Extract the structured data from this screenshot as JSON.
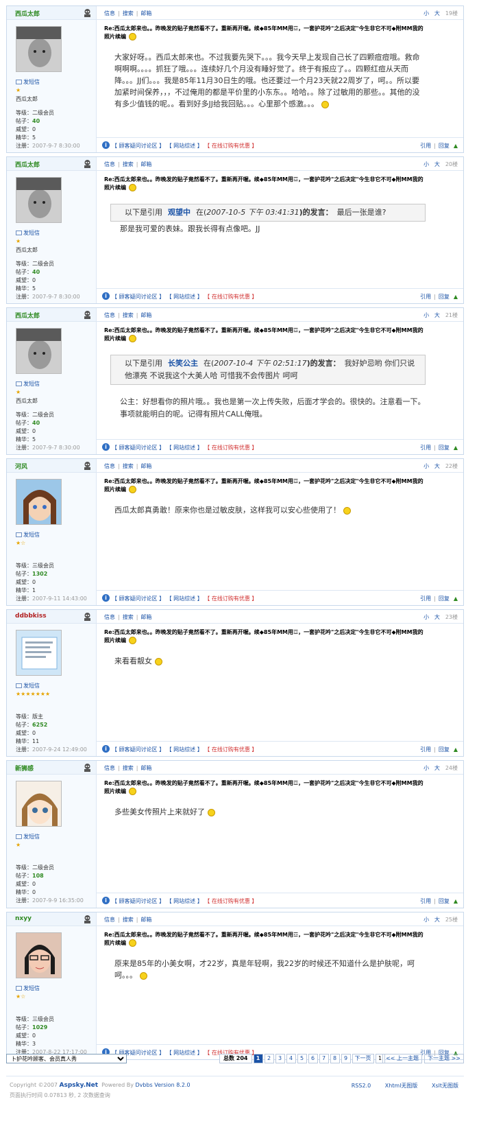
{
  "nav": {
    "info": "信息",
    "search": "搜索",
    "mailbox": "邮箱",
    "sep": "|",
    "small": "小",
    "large": "大"
  },
  "footer_links": {
    "cat": "【 顾客疑问讨论区 】",
    "site": "【 网站综述 】",
    "shop": "【 在线订购有优惠 】",
    "quote": "引用",
    "reply": "回复",
    "sep": "|"
  },
  "labels": {
    "msg": "发短信",
    "posts": "帖子：",
    "prestige": "威望：",
    "essence": "精华：",
    "reg": "注册："
  },
  "post_title": "Re:西瓜太郎来也。。昨晚发的贴子竟然看不了。重新再开喔。续◆85年MM用☲，一套护花吟\"之后决定\"今生非它不可◆附MM我的照片续编",
  "posts": [
    {
      "user": "西瓜太郎",
      "floor": "19楼",
      "stars": "★",
      "rank": "西瓜太郎",
      "level": "等级：二级会员",
      "count": "40",
      "prestige": "0",
      "essence": "5",
      "reg": "2007-9-7 8:30:00",
      "body": "大家好呀。。西瓜太郎来也。不过我要先哭下。。。我今天早上发现自己长了四颗痘痘哦。救命啊啊啊。。。。抓狂了哦。。。连续好几个月没有睡好觉了。终于有报应了。。四颗红痘从天而降。。。JJ们。。。我是85年11月30日生的哦。也还要过一个月23天就22周岁了，呵。。所以要加紧时间保养，，，不过俺用的都是平价里的小东东。。哈哈。。除了过敏用的那些。。其他的没有多少值钱的呢。。看到好多JJ给我回贴。。。心里那个感激。。。"
    },
    {
      "user": "西瓜太郎",
      "floor": "20楼",
      "stars": "★",
      "rank": "西瓜太郎",
      "level": "等级：二级会员",
      "count": "40",
      "prestige": "0",
      "essence": "5",
      "reg": "2007-9-7 8:30:00",
      "quote": {
        "prefix": "以下是引用",
        "name": "观望中",
        "pre_date": "在(",
        "date": "2007-10-5 下午 03:41:31",
        "post_date": ")的发言：",
        "text": "最后一张是谁?"
      },
      "after": "那是我可爱的表妹。跟我长得有点像吧。JJ"
    },
    {
      "user": "西瓜太郎",
      "floor": "21楼",
      "stars": "★",
      "rank": "西瓜太郎",
      "level": "等级：二级会员",
      "count": "40",
      "prestige": "0",
      "essence": "5",
      "reg": "2007-9-7 8:30:00",
      "quote": {
        "prefix": "以下是引用",
        "name": "长笑公主",
        "pre_date": "在(",
        "date": "2007-10-4 下午 02:51:17",
        "post_date": ")的发言：",
        "text": "我好妒忌哟 你们只说他漂亮 不说我这个大美人哈 可惜我不会传图片 呵呵"
      },
      "after": "公主：好想看你的照片哦。。我也是第一次上传失败，后面才学会的。很快的。注意看一下。事项就能明白的呢。记得有照片CALL俺哦。"
    },
    {
      "user": "河风",
      "floor": "22楼",
      "stars": "★☆",
      "rank": "",
      "level": "等级：三级会员",
      "count": "1302",
      "prestige": "0",
      "essence": "1",
      "reg": "2007-9-11 14:43:00",
      "body": "西瓜太郎真勇敢！原来你也是过敏皮肤，这样我可以安心些使用了！"
    },
    {
      "user": "ddbbkiss",
      "floor": "23楼",
      "stars": "★★★★★★★",
      "rank": "",
      "level": "等级：版主",
      "count": "6252",
      "prestige": "0",
      "essence": "11",
      "reg": "2007-9-24 12:49:00",
      "body": "来看看靓女"
    },
    {
      "user": "新狮感",
      "floor": "24楼",
      "stars": "★",
      "rank": "",
      "level": "等级：二级会员",
      "count": "108",
      "prestige": "0",
      "essence": "0",
      "reg": "2007-9-9 16:35:00",
      "body": "多些美女传照片上来就好了"
    },
    {
      "user": "nxyy",
      "floor": "25楼",
      "stars": "★☆",
      "rank": "",
      "level": "等级：三级会员",
      "count": "1029",
      "prestige": "0",
      "essence": "3",
      "reg": "2007-8-22 17:17:00",
      "body": "原来是85年的小美女啊，才22岁，真是年轻啊，我22岁的时候还不知道什么是护肤呢，呵呵。。。"
    }
  ],
  "pager": {
    "select_value": "卜护花吟顾客、会员真人秀",
    "total_label": "总数",
    "total": "204",
    "pages": [
      "1",
      "2",
      "3",
      "4",
      "5",
      "6",
      "7",
      "8",
      "9"
    ],
    "next": "下一页",
    "input": "1",
    "prev_topic": "<< 上一主题",
    "next_topic": "下一主题 >>"
  },
  "footer": {
    "copy": "Copyright ©2007",
    "brand": "Aspsky.Net",
    "powered": "Powered By",
    "dvbbs": "Dvbbs Version 8.2.0",
    "exec": "页面执行时间 0.07813 秒, 2 次数据查询",
    "rss": "RSS2.0",
    "xhtml": "Xhtml无图版",
    "xslt": "Xslt无图版"
  },
  "colors": {
    "link": "#1a52a6",
    "green": "#2f8a22",
    "red": "#d03030",
    "border": "#c9d9ec"
  }
}
